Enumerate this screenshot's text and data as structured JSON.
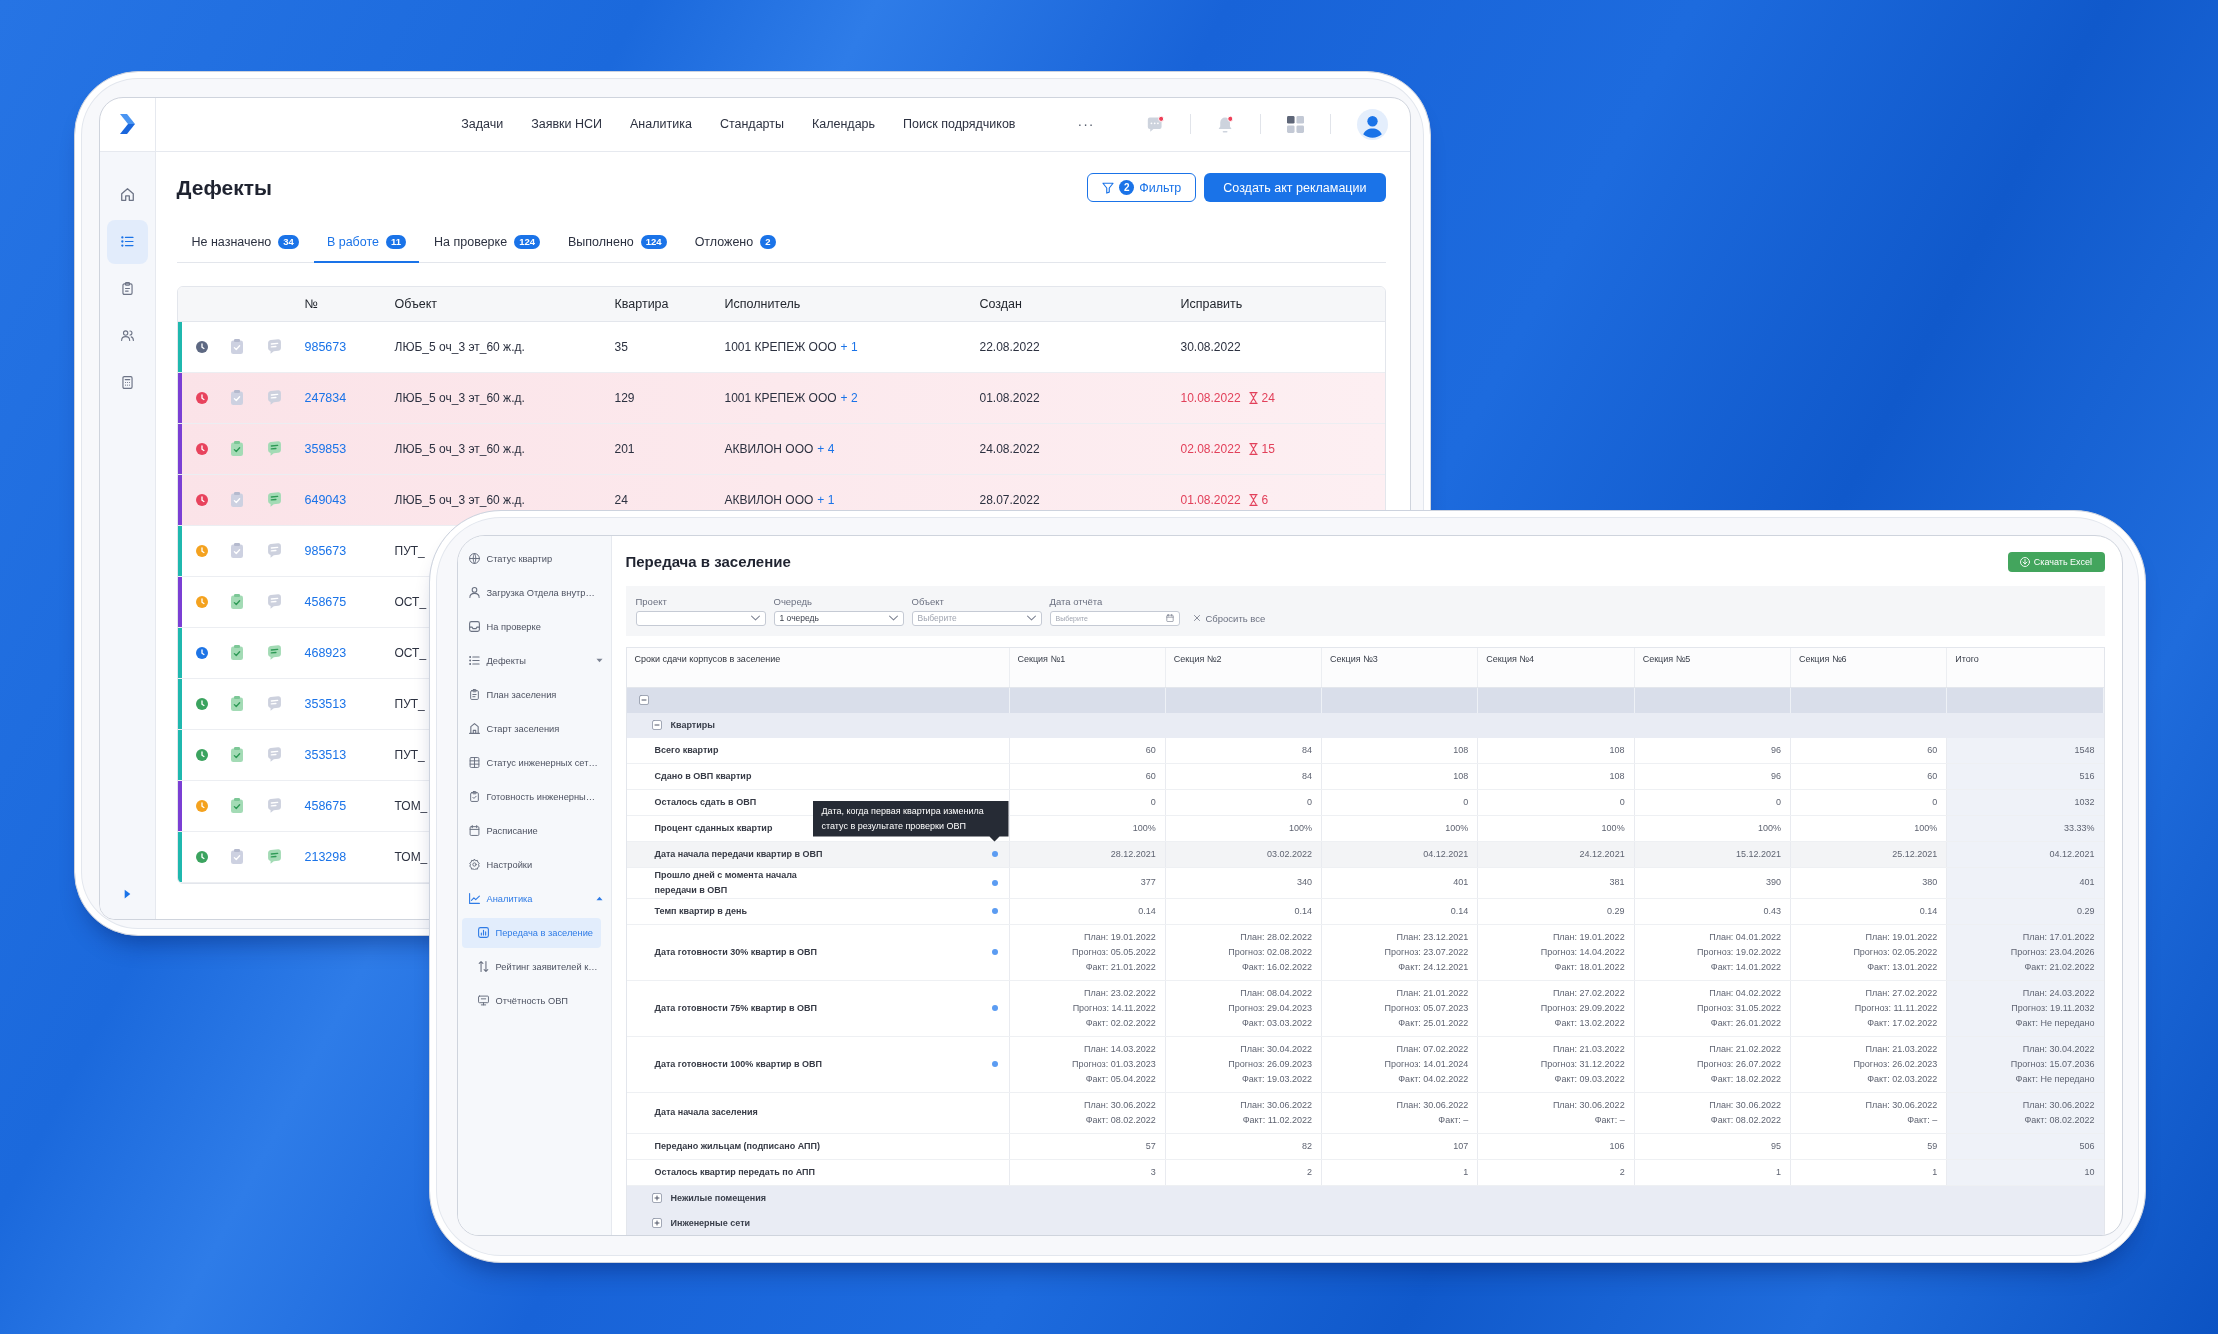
{
  "defects_app": {
    "sidebar": {
      "items": [
        {
          "kind": "home",
          "selected": false
        },
        {
          "kind": "list",
          "selected": true
        },
        {
          "kind": "clipboard",
          "selected": false
        },
        {
          "kind": "users",
          "selected": false
        },
        {
          "kind": "calculator",
          "selected": false
        }
      ]
    },
    "top_nav": {
      "links": [
        "Задачи",
        "Заявки НСИ",
        "Аналитика",
        "Стандарты",
        "Календарь",
        "Поиск подрядчиков"
      ],
      "more": "···",
      "icons": [
        {
          "kind": "chat",
          "unread": true
        },
        {
          "kind": "bell",
          "unread": true
        },
        {
          "kind": "apps",
          "unread": false
        }
      ]
    },
    "title": "Дефекты",
    "filter_button": {
      "label": "Фильтр",
      "count": "2"
    },
    "create_button": "Создать акт рекламации",
    "tabs": [
      {
        "label": "Не назначено",
        "count": "34",
        "selected": false
      },
      {
        "label": "В работе",
        "count": "11",
        "selected": true
      },
      {
        "label": "На проверке",
        "count": "124",
        "selected": false
      },
      {
        "label": "Выполнено",
        "count": "124",
        "selected": false
      },
      {
        "label": "Отложено",
        "count": "2",
        "selected": false
      }
    ],
    "table": {
      "columns": [
        "№",
        "Объект",
        "Квартира",
        "Исполнитель",
        "Создан",
        "Исправить"
      ],
      "rows": [
        {
          "category": {
            "color": "#1fb8ae"
          },
          "status": {
            "color": "#5d6882"
          },
          "document_ok": false,
          "comment_ok": false,
          "overdue": false,
          "number": "985673",
          "object": "ЛЮБ_5 оч_3 эт_60 ж.д.",
          "apartment": "35",
          "executor": "1001 КРЕПЕЖ ООО",
          "executor_more": "+ 1",
          "created": "22.08.2022",
          "due": "30.08.2022"
        },
        {
          "category": {
            "color": "#7b3fd4"
          },
          "status": {
            "color": "#e8435d"
          },
          "document_ok": false,
          "comment_ok": false,
          "overdue": true,
          "number": "247834",
          "object": "ЛЮБ_5 оч_3 эт_60 ж.д.",
          "apartment": "129",
          "executor": "1001 КРЕПЕЖ ООО",
          "executor_more": "+ 2",
          "created": "01.08.2022",
          "due": "10.08.2022",
          "days_count": "24"
        },
        {
          "category": {
            "color": "#7b3fd4"
          },
          "status": {
            "color": "#e8435d"
          },
          "document_ok": true,
          "comment_ok": true,
          "overdue": true,
          "number": "359853",
          "object": "ЛЮБ_5 оч_3 эт_60 ж.д.",
          "apartment": "201",
          "executor": "АКВИЛОН ООО",
          "executor_more": "+ 4",
          "created": "24.08.2022",
          "due": "02.08.2022",
          "days_count": "15"
        },
        {
          "category": {
            "color": "#7b3fd4"
          },
          "status": {
            "color": "#e8435d"
          },
          "document_ok": false,
          "comment_ok": true,
          "overdue": true,
          "number": "649043",
          "object": "ЛЮБ_5 оч_3 эт_60 ж.д.",
          "apartment": "24",
          "executor": "АКВИЛОН ООО",
          "executor_more": "+ 1",
          "created": "28.07.2022",
          "due": "01.08.2022",
          "days_count": "6"
        },
        {
          "category": {
            "color": "#1fb8ae"
          },
          "status": {
            "color": "#f4a21f"
          },
          "document_ok": false,
          "comment_ok": false,
          "overdue": false,
          "number": "985673",
          "object": "ПУТ_"
        },
        {
          "category": {
            "color": "#7b3fd4"
          },
          "status": {
            "color": "#f4a21f"
          },
          "document_ok": true,
          "comment_ok": false,
          "overdue": false,
          "number": "458675",
          "object": "ОСТ_"
        },
        {
          "category": {
            "color": "#1fb8ae"
          },
          "status": {
            "color": "#1d74e6"
          },
          "document_ok": true,
          "comment_ok": true,
          "overdue": false,
          "number": "468923",
          "object": "ОСТ_"
        },
        {
          "category": {
            "color": "#1fb8ae"
          },
          "status": {
            "color": "#3ba35f"
          },
          "document_ok": true,
          "comment_ok": false,
          "overdue": false,
          "number": "353513",
          "object": "ПУТ_"
        },
        {
          "category": {
            "color": "#1fb8ae"
          },
          "status": {
            "color": "#3ba35f"
          },
          "document_ok": true,
          "comment_ok": false,
          "overdue": false,
          "number": "353513",
          "object": "ПУТ_"
        },
        {
          "category": {
            "color": "#7b3fd4"
          },
          "status": {
            "color": "#f4a21f"
          },
          "document_ok": true,
          "comment_ok": false,
          "overdue": false,
          "number": "458675",
          "object": "ТОМ_"
        },
        {
          "category": {
            "color": "#1fb8ae"
          },
          "status": {
            "color": "#3ba35f"
          },
          "document_ok": false,
          "comment_ok": true,
          "overdue": false,
          "number": "213298",
          "object": "ТОМ_"
        }
      ]
    }
  },
  "settlement_app": {
    "sidebar": {
      "items": [
        {
          "kind": "globe",
          "label": "Статус квартир",
          "selected": false
        },
        {
          "kind": "user",
          "label": "Загрузка Отдела внутр…",
          "selected": false
        },
        {
          "kind": "inbox",
          "label": "На проверке",
          "selected": false
        },
        {
          "kind": "list",
          "label": "Дефекты",
          "selected": false,
          "expanded": false
        },
        {
          "kind": "clipboard",
          "label": "План заселения",
          "selected": false
        },
        {
          "kind": "building",
          "label": "Старт заселения",
          "selected": false
        },
        {
          "kind": "table",
          "label": "Статус инженерных сет…",
          "selected": false
        },
        {
          "kind": "checklist",
          "label": "Готовность инженерны…",
          "selected": false
        },
        {
          "kind": "calendar",
          "label": "Расписание",
          "selected": false
        },
        {
          "kind": "gear",
          "label": "Настройки",
          "selected": false
        },
        {
          "kind": "chart",
          "label": "Аналитика",
          "selected": false,
          "expanded": true,
          "children": [
            {
              "kind": "document",
              "label": "Передача в заселение",
              "selected": true
            },
            {
              "kind": "sort",
              "label": "Рейтинг заявителей к…",
              "selected": false
            },
            {
              "kind": "monitor",
              "label": "Отчётность ОВП",
              "selected": false
            }
          ]
        }
      ]
    },
    "title": "Передача в заселение",
    "export_button": "Скачать Excel",
    "filters": [
      {
        "kind": "select",
        "label": "Проект"
      },
      {
        "kind": "select",
        "label": "Очередь",
        "value": "1 очередь"
      },
      {
        "kind": "select",
        "label": "Объект",
        "placeholder": "Выберите"
      },
      {
        "kind": "date",
        "label": "Дата отчёта",
        "placeholder": "Выберите"
      }
    ],
    "reset_button": "Сбросить все",
    "table": {
      "columns": [
        {
          "kind": "label",
          "label": "Сроки сдачи корпусов в заселение"
        },
        {
          "kind": "section",
          "label": "Секция №1"
        },
        {
          "kind": "section",
          "label": "Секция №2"
        },
        {
          "kind": "section",
          "label": "Секция №3"
        },
        {
          "kind": "section",
          "label": "Секция №4"
        },
        {
          "kind": "section",
          "label": "Секция №5"
        },
        {
          "kind": "section",
          "label": "Секция №6"
        },
        {
          "kind": "total",
          "label": "Итого"
        }
      ],
      "rows": [
        {
          "kind": "group",
          "expanded": true
        },
        {
          "kind": "subgroup",
          "label": "Квартиры",
          "expanded": true
        },
        {
          "kind": "metric",
          "label": "Всего квартир",
          "info": false,
          "hovered": false,
          "values": [
            "60",
            "84",
            "108",
            "108",
            "96",
            "60",
            "1548"
          ]
        },
        {
          "kind": "metric",
          "label": "Сдано в ОВП квартир",
          "info": false,
          "hovered": false,
          "values": [
            "60",
            "84",
            "108",
            "108",
            "96",
            "60",
            "516"
          ]
        },
        {
          "kind": "metric",
          "label": "Осталось сдать в ОВП",
          "info": false,
          "hovered": false,
          "values": [
            "0",
            "0",
            "0",
            "0",
            "0",
            "0",
            "1032"
          ]
        },
        {
          "kind": "metric",
          "label": "Процент сданных квартир",
          "info": false,
          "hovered": false,
          "values": [
            "100%",
            "100%",
            "100%",
            "100%",
            "100%",
            "100%",
            "33.33%"
          ]
        },
        {
          "kind": "metric",
          "label": "Дата начала передачи квартир в ОВП",
          "info": true,
          "hovered": true,
          "tooltip": "Дата, когда первая квартира изменила статус в результате проверки ОВП",
          "values": [
            "28.12.2021",
            "03.02.2022",
            "04.12.2021",
            "24.12.2021",
            "15.12.2021",
            "25.12.2021",
            "04.12.2021"
          ]
        },
        {
          "kind": "metric",
          "label": "Прошло дней с момента начала передачи в ОВП",
          "info": true,
          "hovered": false,
          "values": [
            "377",
            "340",
            "401",
            "381",
            "390",
            "380",
            "401"
          ]
        },
        {
          "kind": "metric",
          "label": "Темп квартир в день",
          "info": true,
          "hovered": false,
          "values": [
            "0.14",
            "0.14",
            "0.14",
            "0.29",
            "0.43",
            "0.14",
            "0.29"
          ]
        },
        {
          "kind": "metric",
          "label": "Дата готовности 30% квартир в ОВП",
          "info": true,
          "hovered": false,
          "values": [
            [
              "План: 19.01.2022",
              "Прогноз: 05.05.2022",
              "Факт: 21.01.2022"
            ],
            [
              "План: 28.02.2022",
              "Прогноз: 02.08.2022",
              "Факт: 16.02.2022"
            ],
            [
              "План: 23.12.2021",
              "Прогноз: 23.07.2022",
              "Факт: 24.12.2021"
            ],
            [
              "План: 19.01.2022",
              "Прогноз: 14.04.2022",
              "Факт: 18.01.2022"
            ],
            [
              "План: 04.01.2022",
              "Прогноз: 19.02.2022",
              "Факт: 14.01.2022"
            ],
            [
              "План: 19.01.2022",
              "Прогноз: 02.05.2022",
              "Факт: 13.01.2022"
            ],
            [
              "План: 17.01.2022",
              "Прогноз: 23.04.2026",
              "Факт: 21.02.2022"
            ]
          ]
        },
        {
          "kind": "metric",
          "label": "Дата готовности 75% квартир в ОВП",
          "info": true,
          "hovered": false,
          "values": [
            [
              "План: 23.02.2022",
              "Прогноз: 14.11.2022",
              "Факт: 02.02.2022"
            ],
            [
              "План: 08.04.2022",
              "Прогноз: 29.04.2023",
              "Факт: 03.03.2022"
            ],
            [
              "План: 21.01.2022",
              "Прогноз: 05.07.2023",
              "Факт: 25.01.2022"
            ],
            [
              "План: 27.02.2022",
              "Прогноз: 29.09.2022",
              "Факт: 13.02.2022"
            ],
            [
              "План: 04.02.2022",
              "Прогноз: 31.05.2022",
              "Факт: 26.01.2022"
            ],
            [
              "План: 27.02.2022",
              "Прогноз: 11.11.2022",
              "Факт: 17.02.2022"
            ],
            [
              "План: 24.03.2022",
              "Прогноз: 19.11.2032",
              "Факт: Не передано"
            ]
          ]
        },
        {
          "kind": "metric",
          "label": "Дата готовности 100% квартир в ОВП",
          "info": true,
          "hovered": false,
          "values": [
            [
              "План: 14.03.2022",
              "Прогноз: 01.03.2023",
              "Факт: 05.04.2022"
            ],
            [
              "План: 30.04.2022",
              "Прогноз: 26.09.2023",
              "Факт: 19.03.2022"
            ],
            [
              "План: 07.02.2022",
              "Прогноз: 14.01.2024",
              "Факт: 04.02.2022"
            ],
            [
              "План: 21.03.2022",
              "Прогноз: 31.12.2022",
              "Факт: 09.03.2022"
            ],
            [
              "План: 21.02.2022",
              "Прогноз: 26.07.2022",
              "Факт: 18.02.2022"
            ],
            [
              "План: 21.03.2022",
              "Прогноз: 26.02.2023",
              "Факт: 02.03.2022"
            ],
            [
              "План: 30.04.2022",
              "Прогноз: 15.07.2036",
              "Факт: Не передано"
            ]
          ]
        },
        {
          "kind": "metric",
          "label": "Дата начала заселения",
          "info": false,
          "hovered": false,
          "values": [
            [
              "План: 30.06.2022",
              "Факт: 08.02.2022"
            ],
            [
              "План: 30.06.2022",
              "Факт: 11.02.2022"
            ],
            [
              "План: 30.06.2022",
              "Факт: –"
            ],
            [
              "План: 30.06.2022",
              "Факт: –"
            ],
            [
              "План: 30.06.2022",
              "Факт: 08.02.2022"
            ],
            [
              "План: 30.06.2022",
              "Факт: –"
            ],
            [
              "План: 30.06.2022",
              "Факт: 08.02.2022"
            ]
          ]
        },
        {
          "kind": "metric",
          "label": "Передано жильцам (подписано АПП)",
          "info": false,
          "hovered": false,
          "values": [
            "57",
            "82",
            "107",
            "106",
            "95",
            "59",
            "506"
          ]
        },
        {
          "kind": "metric",
          "label": "Осталось квартир передать по АПП",
          "info": false,
          "hovered": false,
          "values": [
            "3",
            "2",
            "1",
            "2",
            "1",
            "1",
            "10"
          ]
        },
        {
          "kind": "subgroup",
          "label": "Нежилые помещения",
          "expanded": false
        },
        {
          "kind": "subgroup",
          "label": "Инженерные сети",
          "expanded": false
        }
      ]
    }
  }
}
